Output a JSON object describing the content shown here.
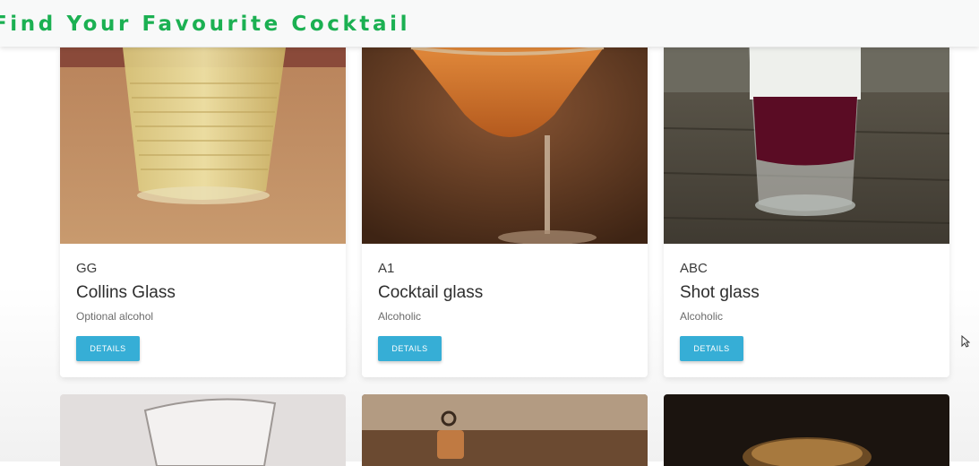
{
  "header": {
    "title": "Find Your Favourite Cocktail"
  },
  "cards": [
    {
      "code": "GG",
      "name": "Collins Glass",
      "category": "Optional alcohol",
      "button_label": "DETAILS"
    },
    {
      "code": "A1",
      "name": "Cocktail glass",
      "category": "Alcoholic",
      "button_label": "DETAILS"
    },
    {
      "code": "ABC",
      "name": "Shot glass",
      "category": "Alcoholic",
      "button_label": "DETAILS"
    }
  ],
  "colors": {
    "brand": "#1bb052",
    "button": "#36aed6"
  },
  "icons": {
    "cursor": "mouse-pointer-icon"
  }
}
